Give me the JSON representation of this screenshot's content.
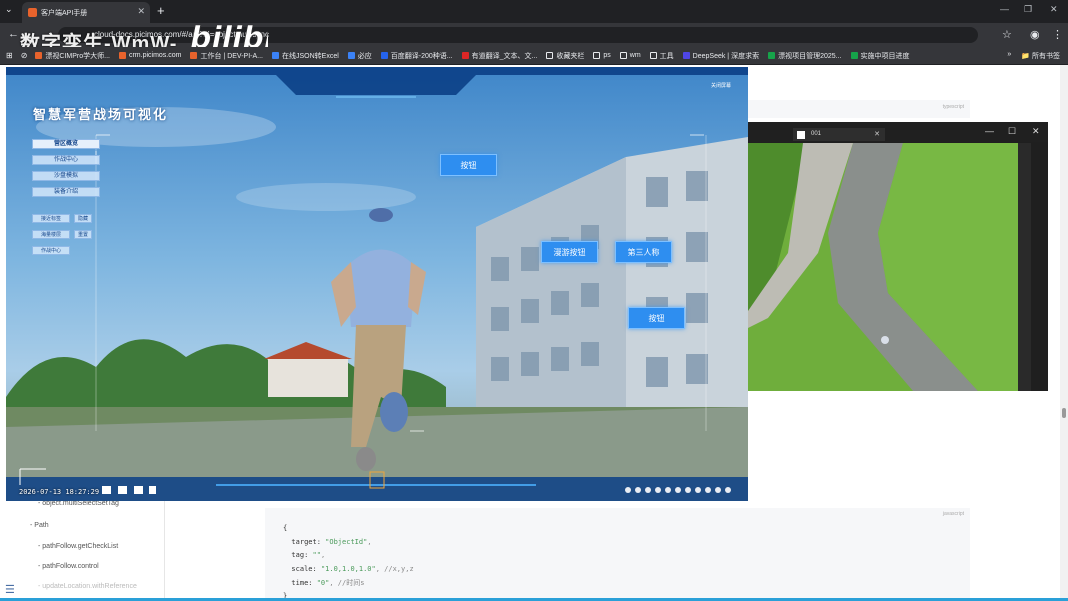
{
  "browser": {
    "tab_title": "客户端API手册",
    "address": "cloud-docs.picimos.com/#/api?id=objectmultisync",
    "watermark": "数字孪生-WmW-",
    "bookmarks": [
      {
        "label": "漂视CIMPro学大师...",
        "icon": "bookmark-icon",
        "color": "#e8632c"
      },
      {
        "label": "crm.picimos.com",
        "icon": "bookmark-icon",
        "color": "#e8632c"
      },
      {
        "label": "工作台 | DEV-PI-A...",
        "icon": "bookmark-icon",
        "color": "#e8632c"
      },
      {
        "label": "在线JSON转Excel",
        "icon": "bookmark-icon",
        "color": "#3b82f6"
      },
      {
        "label": "必应",
        "icon": "search-icon",
        "color": "#3b82f6"
      },
      {
        "label": "百度翻译-200种语...",
        "icon": "bookmark-icon",
        "color": "#2563eb"
      },
      {
        "label": "有道翻译_文本、文...",
        "icon": "bookmark-icon",
        "color": "#dc2626"
      },
      {
        "label": "收藏夹栏",
        "icon": "folder-icon",
        "color": "#e8eaed"
      },
      {
        "label": "ps",
        "icon": "folder-icon",
        "color": "#e8eaed"
      },
      {
        "label": "wm",
        "icon": "folder-icon",
        "color": "#e8eaed"
      },
      {
        "label": "工具",
        "icon": "folder-icon",
        "color": "#e8eaed"
      },
      {
        "label": "DeepSeek | 深度求索",
        "icon": "bookmark-icon",
        "color": "#4f46e5"
      },
      {
        "label": "漂视项目管理2025...",
        "icon": "bookmark-icon",
        "color": "#16a34a"
      },
      {
        "label": "实施中项目进度",
        "icon": "bookmark-icon",
        "color": "#16a34a"
      }
    ],
    "all_bookmarks": "所有书签"
  },
  "game": {
    "title": "智慧军营战场可视化",
    "menu": [
      "营区概览",
      "作战中心",
      "沙盘模拟",
      "装备介绍"
    ],
    "sub_rows": [
      {
        "label": "接近标签",
        "action": "隐藏"
      },
      {
        "label": "海量楼层",
        "action": "重置"
      },
      {
        "label": "作战中心",
        "action": ""
      }
    ],
    "buttons": {
      "btn1": "按钮",
      "roam": "漫游按钮",
      "third_person": "第三人称",
      "btn2": "按钮"
    },
    "timestamp": "2026-07-13 18:27:29",
    "close_label": "关闭屏幕"
  },
  "side_window": {
    "tab_title": "001"
  },
  "doc": {
    "code1_lang": "typescript",
    "code2_lang": "javascript",
    "sidebar": [
      {
        "label": "object.multiSelectSetTag",
        "indent": 38
      },
      {
        "label": "Path",
        "indent": 30
      },
      {
        "label": "pathFollow.getCheckList",
        "indent": 38
      },
      {
        "label": "pathFollow.control",
        "indent": 38
      },
      {
        "label": "updateLocation.withReference",
        "indent": 38
      }
    ],
    "code_lines": [
      {
        "key": "",
        "value": "",
        "comment": "",
        "raw": "{"
      },
      {
        "key": "  target: ",
        "value": "\"ObjectId\"",
        "comment": ","
      },
      {
        "key": "  tag: ",
        "value": "\"\"",
        "comment": ","
      },
      {
        "key": "  scale: ",
        "value": "\"1.0,1.0,1.0\"",
        "comment": ", //x,y,z"
      },
      {
        "key": "  time: ",
        "value": "\"0\"",
        "comment": ", //时间s"
      },
      {
        "key": "",
        "value": "",
        "comment": "",
        "raw": "}"
      }
    ]
  }
}
